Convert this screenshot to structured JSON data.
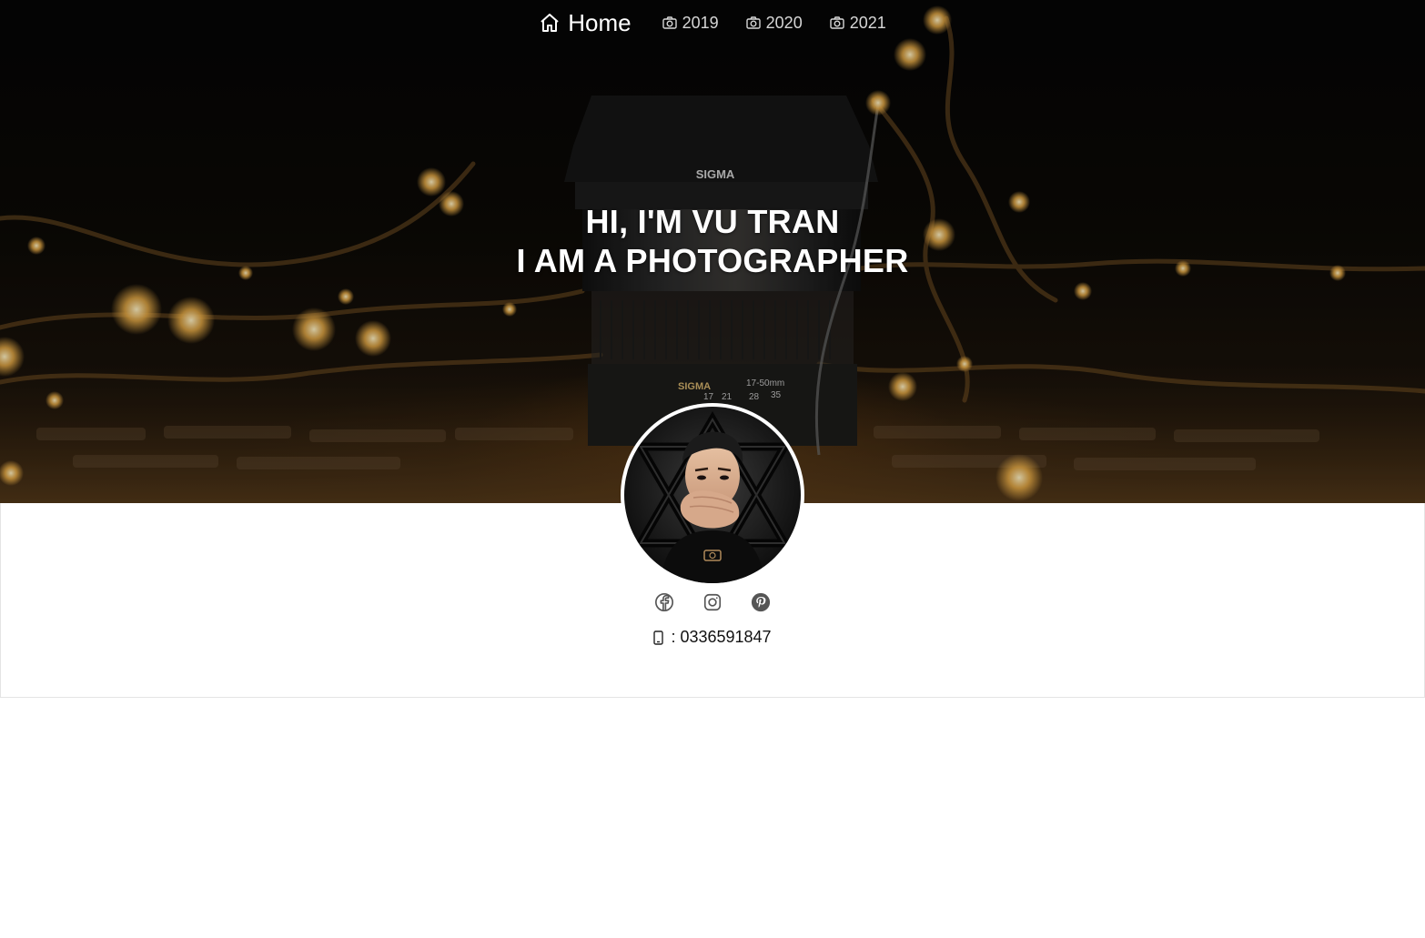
{
  "nav": {
    "home_label": "Home",
    "items": [
      {
        "label": "2019",
        "icon": "camera-icon"
      },
      {
        "label": "2020",
        "icon": "camera-icon"
      },
      {
        "label": "2021",
        "icon": "camera-icon"
      }
    ],
    "home_icon": "home-icon"
  },
  "hero": {
    "line1": "HI, I'M VU TRAN",
    "line2": "I AM A PHOTOGRAPHER",
    "lens_brand": "SIGMA",
    "lens_spec": "17-50mm",
    "lens_scale": [
      "17",
      "21",
      "28",
      "35"
    ]
  },
  "profile": {
    "avatar_icon": "avatar"
  },
  "social": [
    {
      "name": "facebook",
      "icon": "facebook-icon"
    },
    {
      "name": "instagram",
      "icon": "instagram-icon"
    },
    {
      "name": "pinterest",
      "icon": "pinterest-icon"
    }
  ],
  "contact": {
    "separator": ":",
    "phone": "0336591847",
    "icon": "phone-icon"
  },
  "colors": {
    "hero_bg": "#050505",
    "bokeh": "#f3b44a",
    "panel_bg": "#ffffff",
    "icon_gray": "#555555"
  }
}
